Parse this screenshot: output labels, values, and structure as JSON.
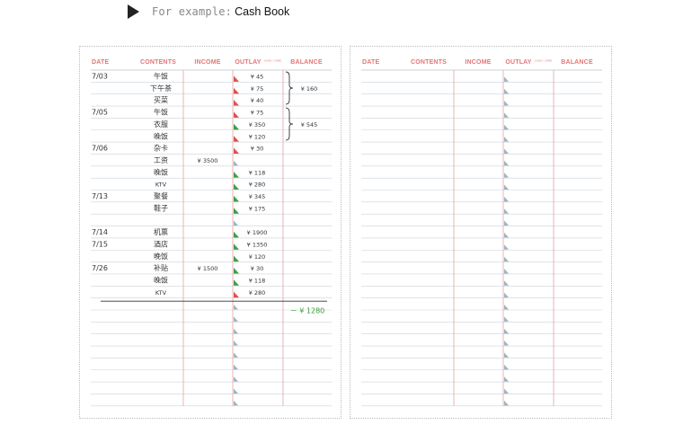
{
  "caption": {
    "prefix": "For example:",
    "title": "Cash Book",
    "icon": "play-triangle-icon"
  },
  "colors": {
    "header": "#e57575",
    "rule": "#c9d3dc",
    "column_line": "#e6a1a1",
    "corner_red": "#e05050",
    "corner_green": "#3aa04a",
    "total_green": "#3a9b3a"
  },
  "columns": [
    "DATE",
    "CONTENTS",
    "INCOME",
    "OUTLAY",
    "BALANCE"
  ],
  "outlay_subtext": "CASH / CARD",
  "entries": [
    {
      "date": "7/03",
      "contents": "午饭",
      "income": "",
      "outlay": "¥ 45",
      "mark": "red"
    },
    {
      "date": "",
      "contents": "下午茶",
      "income": "",
      "outlay": "¥ 75",
      "mark": "red"
    },
    {
      "date": "",
      "contents": "买菜",
      "income": "",
      "outlay": "¥ 40",
      "mark": "red"
    },
    {
      "date": "7/05",
      "contents": "午饭",
      "income": "",
      "outlay": "¥ 75",
      "mark": "red"
    },
    {
      "date": "",
      "contents": "衣服",
      "income": "",
      "outlay": "¥ 350",
      "mark": "green"
    },
    {
      "date": "",
      "contents": "晚饭",
      "income": "",
      "outlay": "¥ 120",
      "mark": "red"
    },
    {
      "date": "7/06",
      "contents": "杂卡",
      "income": "",
      "outlay": "¥ 30",
      "mark": "red"
    },
    {
      "date": "",
      "contents": "工资",
      "income": "¥ 3500",
      "outlay": "",
      "mark": "none"
    },
    {
      "date": "",
      "contents": "晚饭",
      "income": "",
      "outlay": "¥ 118",
      "mark": "green"
    },
    {
      "date": "",
      "contents": "KTV",
      "income": "",
      "outlay": "¥ 280",
      "mark": "green"
    },
    {
      "date": "7/13",
      "contents": "聚餐",
      "income": "",
      "outlay": "¥ 345",
      "mark": "green"
    },
    {
      "date": "",
      "contents": "鞋子",
      "income": "",
      "outlay": "¥ 175",
      "mark": "green"
    },
    {
      "date": "",
      "contents": "",
      "income": "",
      "outlay": "",
      "mark": "none"
    },
    {
      "date": "7/14",
      "contents": "机票",
      "income": "",
      "outlay": "¥ 1900",
      "mark": "green"
    },
    {
      "date": "7/15",
      "contents": "酒店",
      "income": "",
      "outlay": "¥ 1350",
      "mark": "green"
    },
    {
      "date": "",
      "contents": "晚饭",
      "income": "",
      "outlay": "¥ 120",
      "mark": "green"
    },
    {
      "date": "7/26",
      "contents": "补贴",
      "income": "¥ 1500",
      "outlay": "¥ 30",
      "mark": "green"
    },
    {
      "date": "",
      "contents": "晚饭",
      "income": "",
      "outlay": "¥ 118",
      "mark": "green"
    },
    {
      "date": "",
      "contents": "KTV",
      "income": "",
      "outlay": "¥ 280",
      "mark": "red"
    }
  ],
  "balances": [
    {
      "text": "¥ 160",
      "from_row": 0,
      "to_row": 2
    },
    {
      "text": "¥ 545",
      "from_row": 3,
      "to_row": 5
    }
  ],
  "total": "－ ¥ 1280"
}
